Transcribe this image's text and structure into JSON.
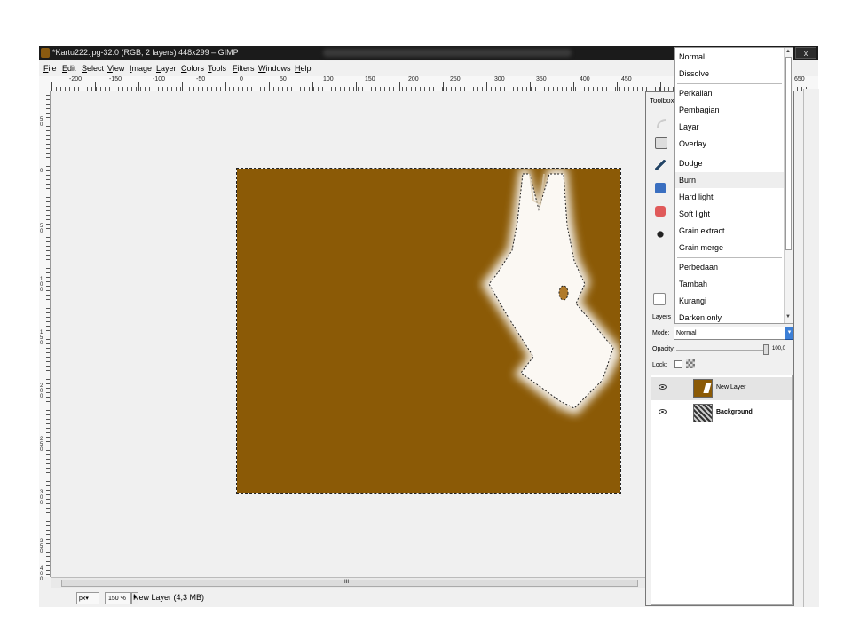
{
  "window": {
    "title": "*Kartu222.jpg-32.0 (RGB, 2 layers) 448x299 – GIMP",
    "close_label": "x"
  },
  "menu": [
    "File",
    "Edit",
    "Select",
    "View",
    "Image",
    "Layer",
    "Colors",
    "Tools",
    "Filters",
    "Windows",
    "Help"
  ],
  "ruler": {
    "labels": [
      "-200",
      "-150",
      "-100",
      "-50",
      "0",
      "50",
      "100",
      "150",
      "200",
      "250",
      "300",
      "350",
      "400",
      "450",
      "650"
    ],
    "vertical_labels": [
      "50",
      "0",
      "50",
      "100",
      "150",
      "200",
      "250",
      "300",
      "350",
      "400"
    ]
  },
  "colors": {
    "image_fill": "#8b5a06",
    "selection_accent": "#3c7fd6"
  },
  "statusbar": {
    "unit": "px",
    "zoom": "150 %",
    "message": "New Layer (4,3 MB)"
  },
  "scroll_center_label": "III",
  "dock": {
    "title": "Toolbox",
    "layers_tab": "Layers",
    "mode_label": "Mode:",
    "mode_value": "Normal",
    "opacity_label": "Opacity:",
    "opacity_value": "100,0",
    "lock_label": "Lock:",
    "layers": [
      {
        "name": "New Layer",
        "active": true,
        "bold": false
      },
      {
        "name": "Background",
        "active": false,
        "bold": true
      }
    ]
  },
  "mode_popup": {
    "options": [
      "Normal",
      "Dissolve",
      "Perkalian",
      "Pembagian",
      "Layar",
      "Overlay",
      "Dodge",
      "Burn",
      "Hard light",
      "Soft light",
      "Grain extract",
      "Grain merge",
      "Perbedaan",
      "Tambah",
      "Kurangi",
      "Darken only"
    ],
    "highlighted": "Burn"
  }
}
